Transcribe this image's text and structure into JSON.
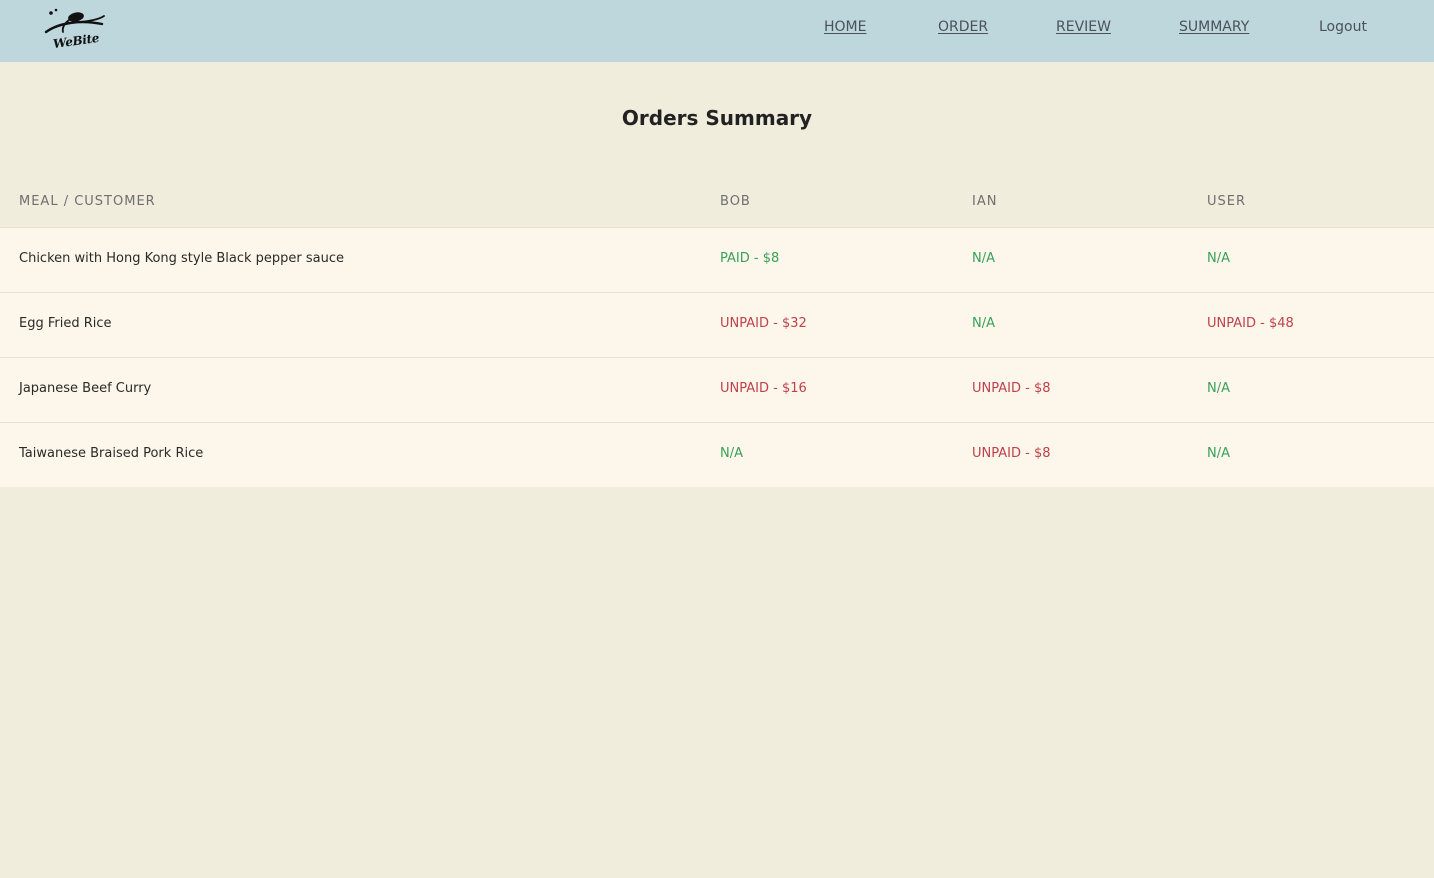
{
  "app": {
    "logo_text": "WeBite"
  },
  "nav": {
    "home": "HOME",
    "order": "ORDER",
    "review": "REVIEW",
    "summary": "SUMMARY",
    "logout": "Logout"
  },
  "page": {
    "title": "Orders Summary"
  },
  "table": {
    "headers": [
      "MEAL / CUSTOMER",
      "BOB",
      "IAN",
      "USER"
    ],
    "rows": [
      [
        "Chicken with Hong Kong style Black pepper sauce",
        "PAID - $8",
        "N/A",
        "N/A"
      ],
      [
        "Egg Fried Rice",
        "UNPAID - $32",
        "N/A",
        "UNPAID - $48"
      ],
      [
        "Japanese Beef Curry",
        "UNPAID - $16",
        "UNPAID - $8",
        "N/A"
      ],
      [
        "Taiwanese Braised Pork Rice",
        "N/A",
        "UNPAID - $8",
        "N/A"
      ]
    ]
  },
  "colors": {
    "navbar": "#bdd7dd",
    "background": "#f0eddd",
    "row": "#fcf7ea",
    "paid": "#3aa05a",
    "unpaid": "#c0404d"
  },
  "icons": {
    "logo": "webite-spoon-logo"
  }
}
